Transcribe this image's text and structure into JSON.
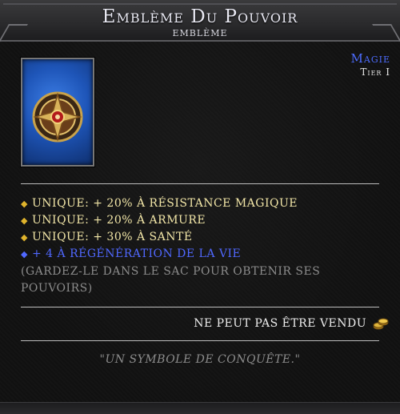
{
  "tooltip": {
    "title": "Emblème Du Pouvoir",
    "subtitle": "Emblème",
    "rarity": "Magie",
    "tier": "Tier I",
    "icon": "golden-emblem-icon",
    "frame_color": "#1e55b8",
    "stats": [
      {
        "text": "Unique: + 20% à Résistance Magique",
        "color": "#f3e7a8"
      },
      {
        "text": "Unique: + 20% à Armure",
        "color": "#f3e7a8"
      },
      {
        "text": "Unique: + 30% à Santé",
        "color": "#f3e7a8"
      },
      {
        "text": "+ 4 à Régénération de la Vie",
        "color": "#5068ff"
      }
    ],
    "note": "(Gardez-le dans le sac pour obtenir ses pouvoirs)",
    "sell_text": "Ne peut pas être vendu",
    "sell_icon": "gold-coins-icon",
    "flavor": "\"Un symbole de conquête.\""
  }
}
